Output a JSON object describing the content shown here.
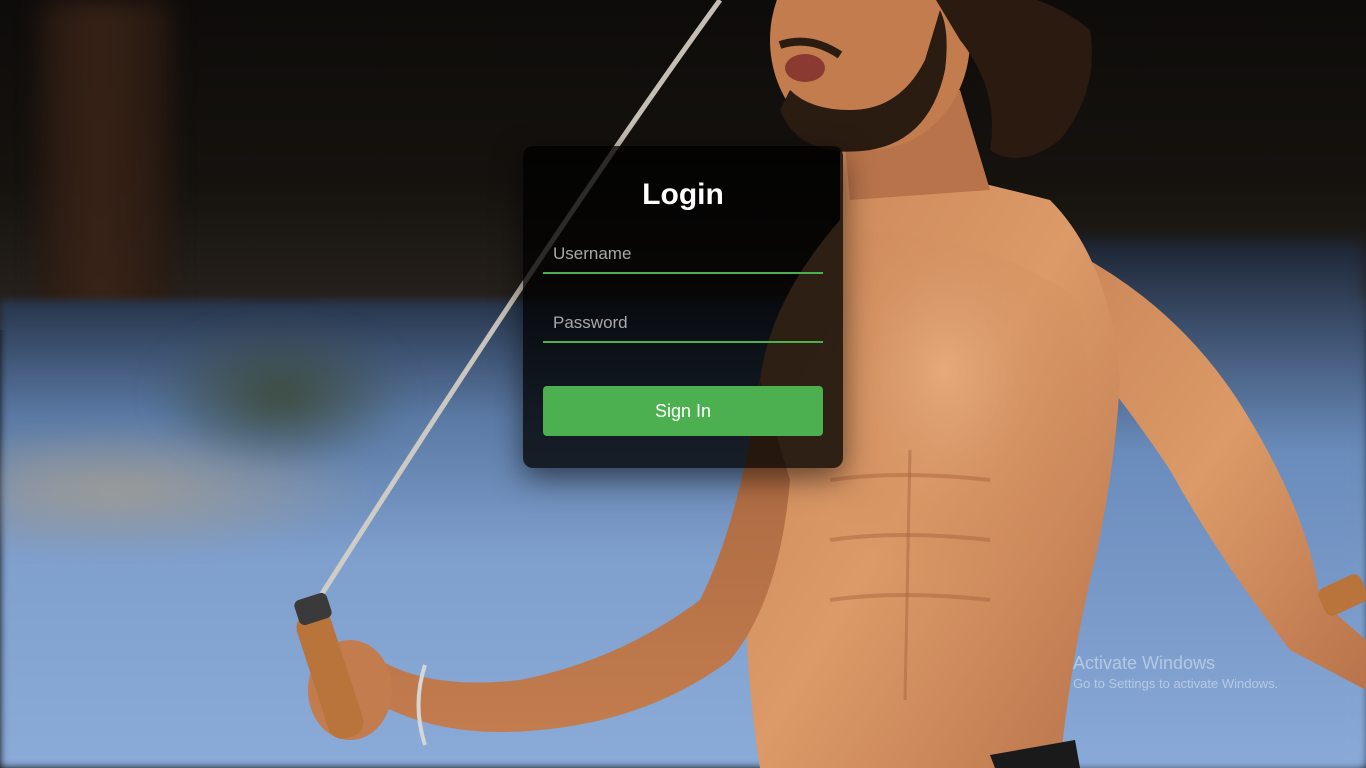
{
  "login": {
    "title": "Login",
    "username_placeholder": "Username",
    "password_placeholder": "Password",
    "signin_label": "Sign In"
  },
  "watermark": {
    "title": "Activate Windows",
    "subtitle": "Go to Settings to activate Windows."
  },
  "colors": {
    "accent": "#4caf50",
    "card_background": "rgba(0,0,0,0.78)"
  }
}
